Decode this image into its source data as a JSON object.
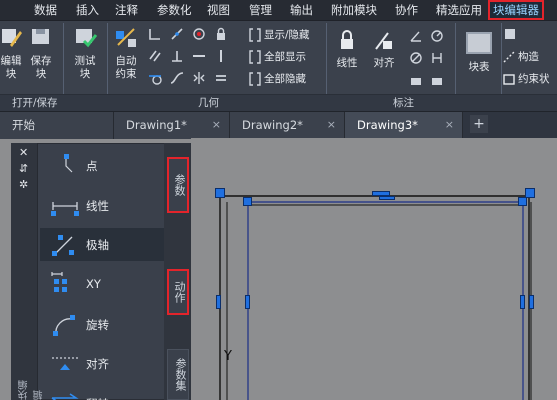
{
  "menubar": {
    "items": [
      "数据",
      "插入",
      "注释",
      "参数化",
      "视图",
      "管理",
      "输出",
      "附加模块",
      "协作",
      "精选应用",
      "块编辑器"
    ],
    "active": "块编辑器"
  },
  "ribbon": {
    "open_save": {
      "edit_block": "编辑\n块",
      "save_block": "保存\n块",
      "title": "打开/保存"
    },
    "test": {
      "test_block": "测试\n块"
    },
    "geometry": {
      "auto_constrain": "自动\n约束",
      "title": "几何"
    },
    "visibility": {
      "show_hide": "显示/隐藏",
      "show_all": "全部显示",
      "hide_all": "全部隐藏"
    },
    "dimension": {
      "linear": "线性",
      "aligned": "对齐",
      "title": "标注"
    },
    "block_table": "块表",
    "construction": "构造",
    "constraint_status": "约束状"
  },
  "tabs": [
    {
      "label": "开始",
      "closable": false,
      "active": false
    },
    {
      "label": "Drawing1*",
      "closable": true,
      "active": false
    },
    {
      "label": "Drawing2*",
      "closable": true,
      "active": false
    },
    {
      "label": "Drawing3*",
      "closable": true,
      "active": true
    }
  ],
  "tab_close_glyph": "×",
  "tab_add_glyph": "+",
  "palette": {
    "controls": {
      "close": "✕",
      "pin": "⇵",
      "settings": "✲"
    },
    "strip_label": "块编辑",
    "items": [
      {
        "label": "点",
        "icon": "point-parameter-icon"
      },
      {
        "label": "线性",
        "icon": "linear-parameter-icon"
      },
      {
        "label": "极轴",
        "icon": "polar-parameter-icon",
        "selected": true
      },
      {
        "label": "XY",
        "icon": "xy-parameter-icon"
      },
      {
        "label": "旋转",
        "icon": "rotation-parameter-icon"
      },
      {
        "label": "对齐",
        "icon": "alignment-parameter-icon"
      },
      {
        "label": "翻转",
        "icon": "flip-parameter-icon"
      }
    ],
    "tabs": [
      {
        "label": "参数",
        "outlined": true
      },
      {
        "label": "动作",
        "outlined": true
      },
      {
        "label": "参数集",
        "outlined": false
      }
    ]
  },
  "canvas": {
    "ucs_label": "Y",
    "accent": "#1f6fe0"
  }
}
